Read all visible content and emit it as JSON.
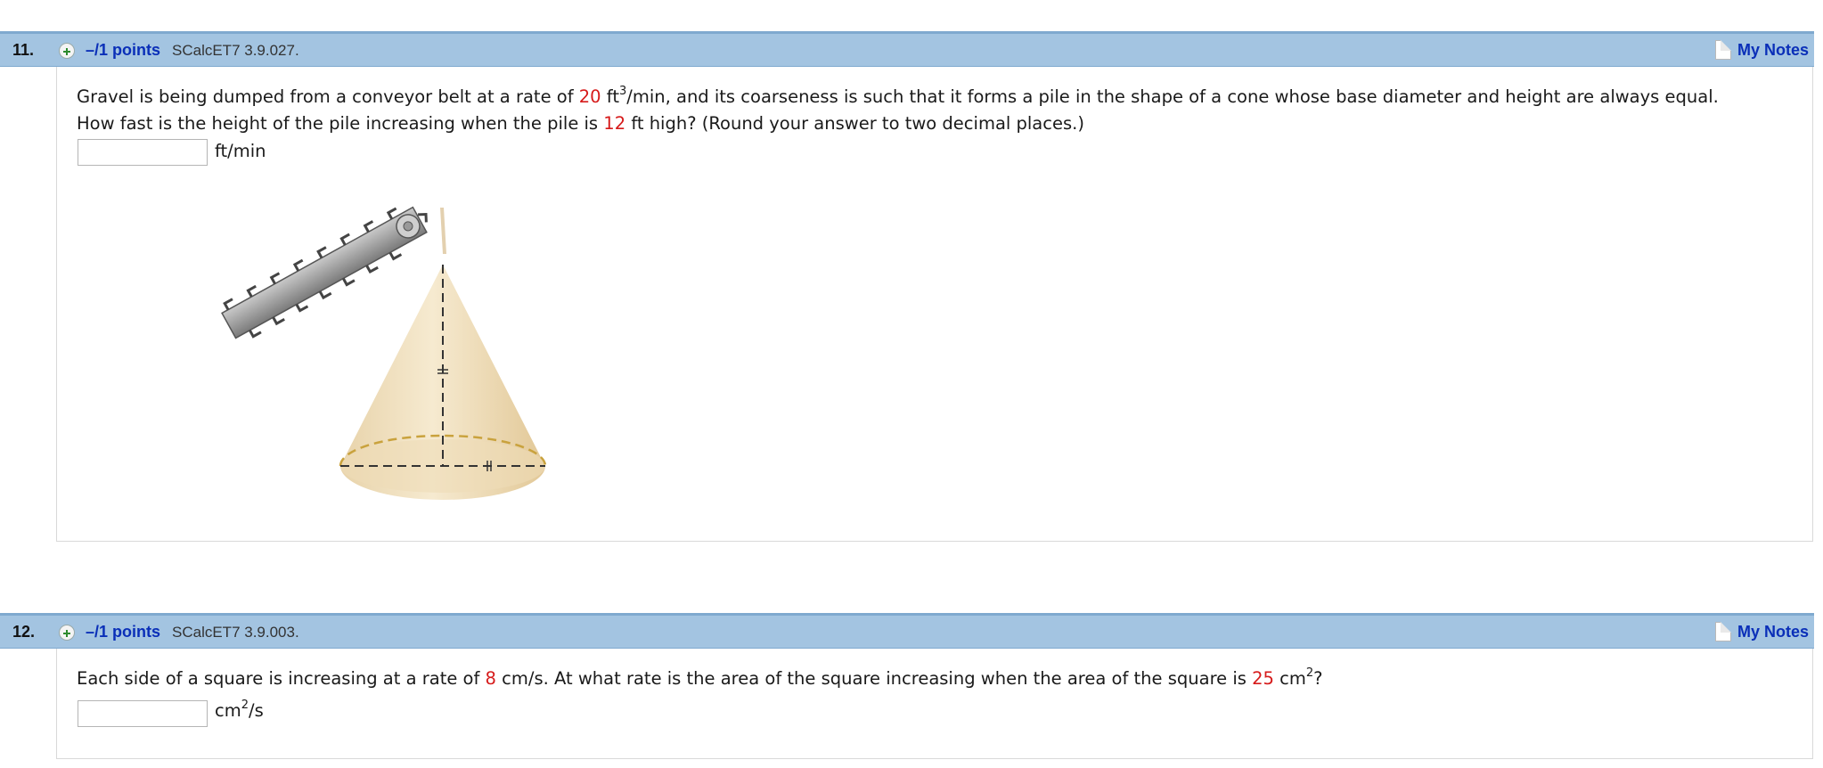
{
  "questions": [
    {
      "number": "11.",
      "points": "–/1 points",
      "code": "SCalcET7 3.9.027.",
      "notes_label": "My Notes",
      "line1_a": "Gravel is being dumped from a conveyor belt at a rate of ",
      "line1_rate": "20",
      "line1_b": " ft",
      "line1_sup": "3",
      "line1_c": "/min, and its coarseness is such that it forms a pile in the shape of a cone whose base diameter and height are always equal.",
      "line2_a": "How fast is the height of the pile increasing when the pile is ",
      "line2_height": "12",
      "line2_b": " ft high? (Round your answer to two decimal places.)",
      "answer_value": "",
      "unit": "ft/min"
    },
    {
      "number": "12.",
      "points": "–/1 points",
      "code": "SCalcET7 3.9.003.",
      "notes_label": "My Notes",
      "line1_a": "Each side of a square is increasing at a rate of ",
      "line1_rate": "8",
      "line1_b": " cm/s. At what rate is the area of the square increasing when the area of the square is ",
      "line1_area": "25",
      "line1_c": " cm",
      "line1_sup": "2",
      "line1_d": "?",
      "answer_value": "",
      "unit_a": "cm",
      "unit_sup": "2",
      "unit_b": "/s"
    }
  ],
  "colors": {
    "header_bg": "#a3c4e1",
    "link_blue": "#0a2fb8",
    "value_red": "#d61a1a"
  }
}
